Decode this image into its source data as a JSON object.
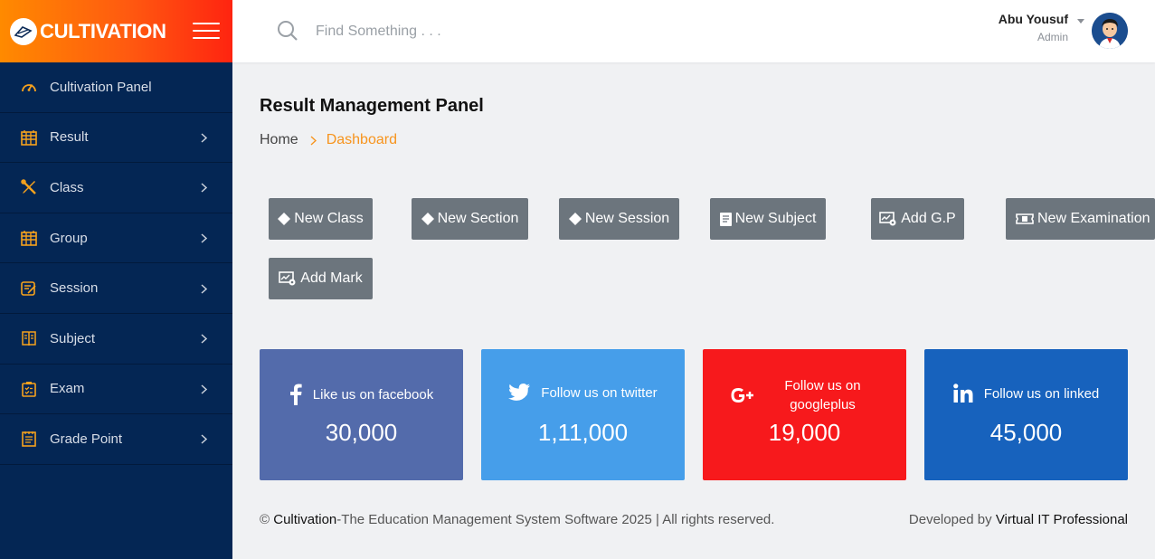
{
  "brand": {
    "name": "CULTIVATION"
  },
  "sidebar": {
    "items": [
      {
        "label": "Cultivation Panel",
        "icon": "gauge-icon"
      },
      {
        "label": "Result",
        "icon": "table-icon"
      },
      {
        "label": "Class",
        "icon": "tools-icon"
      },
      {
        "label": "Group",
        "icon": "table-icon"
      },
      {
        "label": "Session",
        "icon": "edit-icon"
      },
      {
        "label": "Subject",
        "icon": "book-icon"
      },
      {
        "label": "Exam",
        "icon": "clipboard-icon"
      },
      {
        "label": "Grade Point",
        "icon": "notepad-icon"
      }
    ]
  },
  "header": {
    "search_placeholder": "Find Something . . .",
    "user_name": "Abu Yousuf",
    "user_role": "Admin"
  },
  "main": {
    "title": "Result Management Panel",
    "breadcrumb": {
      "home": "Home",
      "current": "Dashboard"
    },
    "actions": [
      {
        "label": "New Class",
        "icon": "diamond-icon"
      },
      {
        "label": "New Section",
        "icon": "diamond-icon"
      },
      {
        "label": "New Session",
        "icon": "diamond-icon"
      },
      {
        "label": "New Subject",
        "icon": "book-icon"
      },
      {
        "label": "Add G.P",
        "icon": "chart-settings-icon"
      },
      {
        "label": "New Examination",
        "icon": "ticket-icon"
      },
      {
        "label": "Add Mark",
        "icon": "chart-settings-icon"
      }
    ],
    "social": [
      {
        "label": "Like us on facebook",
        "count": "30,000",
        "icon": "facebook-icon",
        "color": "#536bab"
      },
      {
        "label": "Follow us on twitter",
        "count": "1,11,000",
        "icon": "twitter-icon",
        "color": "#469eea"
      },
      {
        "label": "Follow us on googleplus",
        "count": "19,000",
        "icon": "google-plus-icon",
        "color": "#f7191c"
      },
      {
        "label": "Follow us on linked",
        "count": "45,000",
        "icon": "linkedin-icon",
        "color": "#1762bd"
      }
    ]
  },
  "footer": {
    "copy_prefix": "©",
    "brand": "Cultivation",
    "copy_text": "-The Education Management System Software 2025 | All rights reserved.",
    "dev_prefix": "Developed by",
    "developer": "Virtual IT Professional"
  },
  "colors": {
    "accent": "#f7941d",
    "sidebar_bg": "#042654",
    "button_bg": "#6c757d"
  }
}
